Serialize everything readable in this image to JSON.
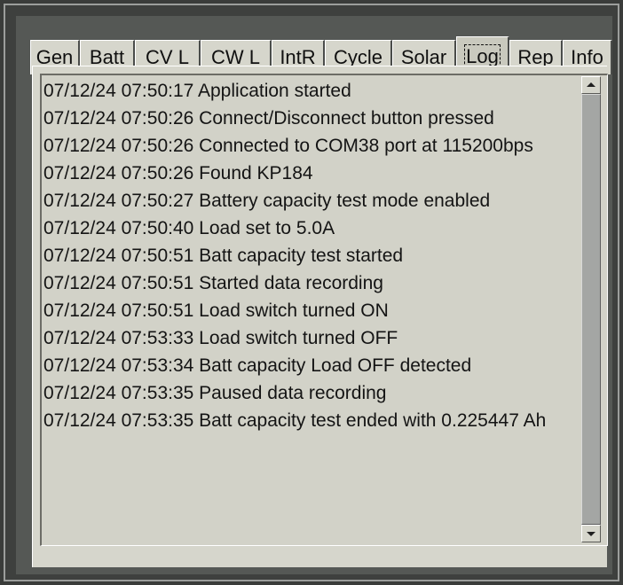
{
  "tabs": [
    {
      "label": "Gen",
      "active": false
    },
    {
      "label": "Batt",
      "active": false
    },
    {
      "label": "CV L",
      "active": false
    },
    {
      "label": "CW L",
      "active": false
    },
    {
      "label": "IntR",
      "active": false
    },
    {
      "label": "Cycle",
      "active": false
    },
    {
      "label": "Solar",
      "active": false
    },
    {
      "label": "Log",
      "active": true
    },
    {
      "label": "Rep",
      "active": false
    },
    {
      "label": "Info",
      "active": false
    }
  ],
  "log": {
    "lines": [
      "07/12/24 07:50:17 Application started",
      "07/12/24 07:50:26 Connect/Disconnect button pressed",
      "07/12/24 07:50:26 Connected to COM38 port at 115200bps",
      "07/12/24 07:50:26 Found KP184",
      "07/12/24 07:50:27 Battery capacity test mode enabled",
      "07/12/24 07:50:40 Load set to 5.0A",
      "07/12/24 07:50:51 Batt capacity test started",
      "07/12/24 07:50:51 Started data recording",
      "07/12/24 07:50:51 Load switch turned ON",
      "07/12/24 07:53:33 Load switch turned OFF",
      "07/12/24 07:53:34 Batt capacity Load OFF detected",
      "07/12/24 07:53:35 Paused data recording",
      "07/12/24 07:53:35 Batt capacity test ended with 0.225447 Ah"
    ]
  },
  "colors": {
    "background": "#3a3c3a",
    "panel": "#d6d6cc",
    "text": "#141414"
  }
}
